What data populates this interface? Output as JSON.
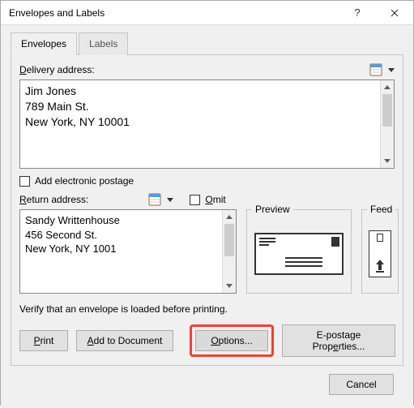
{
  "window": {
    "title": "Envelopes and Labels"
  },
  "tabs": {
    "envelopes": "Envelopes",
    "labels": "Labels"
  },
  "delivery": {
    "label": "Delivery address:",
    "text": "Jim Jones\n789 Main St.\nNew York, NY 10001"
  },
  "electronicPostage": {
    "label": "Add electronic postage"
  },
  "returnAddr": {
    "label": "Return address:",
    "omitLabel": "Omit",
    "text": "Sandy Writtenhouse\n456 Second St.\nNew York, NY 1001"
  },
  "preview": {
    "label": "Preview"
  },
  "feed": {
    "label": "Feed"
  },
  "verify": "Verify that an envelope is loaded before printing.",
  "buttons": {
    "print_u": "P",
    "print_rest": "rint",
    "addDoc_u": "A",
    "addDoc_rest": "dd to Document",
    "options_u": "O",
    "options_rest": "ptions...",
    "epost_pre": "E-postage Prop",
    "epost_u": "e",
    "epost_post": "rties...",
    "cancel": "Cancel"
  }
}
